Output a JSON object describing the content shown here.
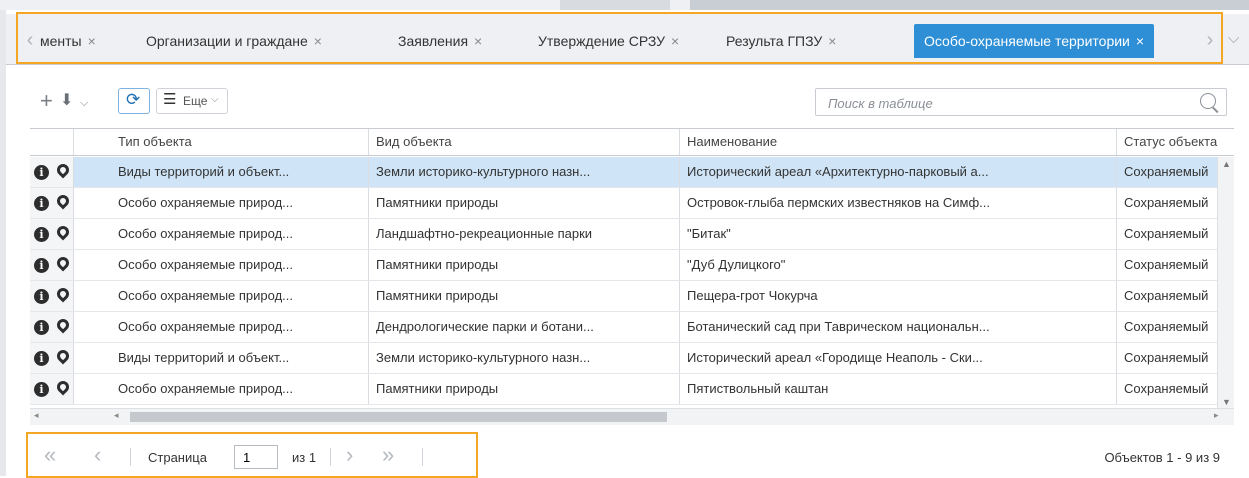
{
  "tabs": [
    {
      "label": "менты",
      "close": "×",
      "active": false
    },
    {
      "label": "Организации и граждане",
      "close": "×",
      "active": false
    },
    {
      "label": "Заявления",
      "close": "×",
      "active": false
    },
    {
      "label": "Утверждение СРЗУ",
      "close": "×",
      "active": false
    },
    {
      "label": "Результа ГПЗУ",
      "close": "×",
      "active": false
    },
    {
      "label": "Особо-охраняемые территории",
      "close": "×",
      "active": true
    }
  ],
  "toolbar": {
    "more_label": "Еще",
    "search_placeholder": "Поиск в таблице"
  },
  "grid": {
    "columns": [
      "Тип объекта",
      "Вид объекта",
      "Наименование",
      "Статус объекта"
    ],
    "rows": [
      [
        "Виды территорий и объект...",
        "Земли историко-культурного назн...",
        "Исторический ареал «Архитектурно-парковый а...",
        "Сохраняемый"
      ],
      [
        "Особо охраняемые природ...",
        "Памятники природы",
        "Островок-глыба пермских известняков на Симф...",
        "Сохраняемый"
      ],
      [
        "Особо охраняемые природ...",
        "Ландшафтно-рекреационные парки",
        "\"Битак\"",
        "Сохраняемый"
      ],
      [
        "Особо охраняемые природ...",
        "Памятники природы",
        "\"Дуб Дулицкого\"",
        "Сохраняемый"
      ],
      [
        "Особо охраняемые природ...",
        "Памятники природы",
        "Пещера-грот Чокурча",
        "Сохраняемый"
      ],
      [
        "Особо охраняемые природ...",
        "Дендрологические парки и ботани...",
        "Ботанический сад при Таврическом национальн...",
        "Сохраняемый"
      ],
      [
        "Виды территорий и объект...",
        "Земли историко-культурного назн...",
        "Исторический ареал «Городище Неаполь - Ски...",
        "Сохраняемый"
      ],
      [
        "Особо охраняемые природ...",
        "Памятники природы",
        "Пятиствольный каштан",
        "Сохраняемый"
      ]
    ],
    "selected_row": 0
  },
  "pager": {
    "page_label": "Страница",
    "page_value": "1",
    "of_label": "из 1",
    "count_text": "Объектов 1 - 9 из 9"
  },
  "colors": {
    "accent": "#2e8fd6",
    "highlight_frame": "#f5a623",
    "selected_row": "#cfe5f7"
  }
}
